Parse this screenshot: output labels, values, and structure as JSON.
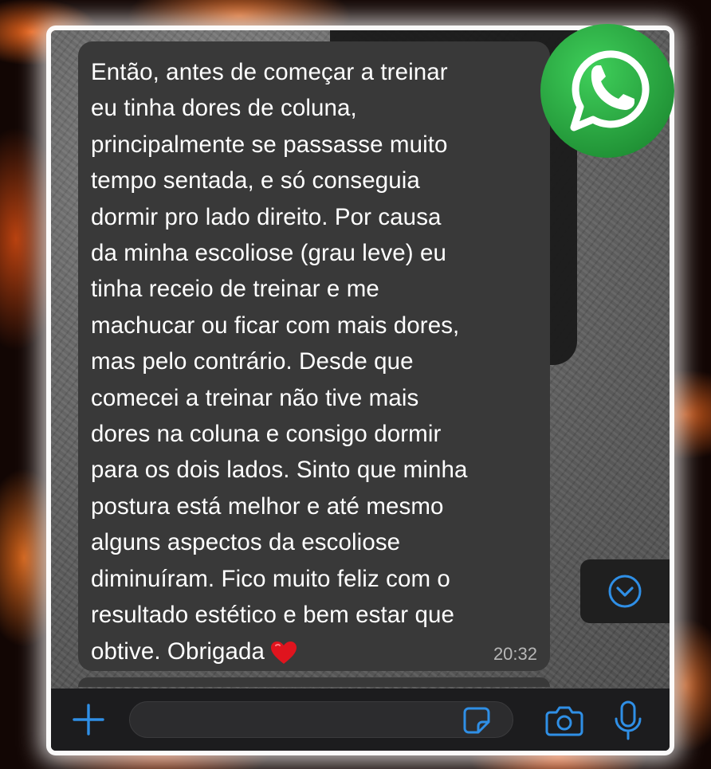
{
  "chat": {
    "message": {
      "text": "Então, antes de começar a treinar\neu tinha dores de coluna,\nprincipalmente se passasse muito\ntempo sentada, e só conseguia\ndormir pro lado direito. Por causa\nda minha escoliose (grau leve) eu\ntinha receio de treinar e me\nmachucar ou ficar com mais dores,\nmas pelo contrário. Desde que\ncomecei a treinar não tive mais\ndores na coluna e consigo dormir\npara os dois lados. Sinto que minha\npostura está melhor e até mesmo\nalguns aspectos da escoliose\ndiminuíram. Fico muito feliz com o\nresultado estético e bem estar que\nobtive. Obrigada",
      "emoji": "red-heart",
      "time": "20:32"
    }
  },
  "input_bar": {
    "text_value": "",
    "placeholder": "",
    "icons": [
      "plus-icon",
      "sticker-icon",
      "camera-icon",
      "microphone-icon"
    ]
  },
  "scroll_button": {
    "icon": "chevron-down-icon"
  },
  "overlay": {
    "logo": "whatsapp-logo"
  },
  "colors": {
    "accent": "#2f8fe6",
    "bubble": "#393939",
    "whatsapp_green": "#2db742"
  }
}
